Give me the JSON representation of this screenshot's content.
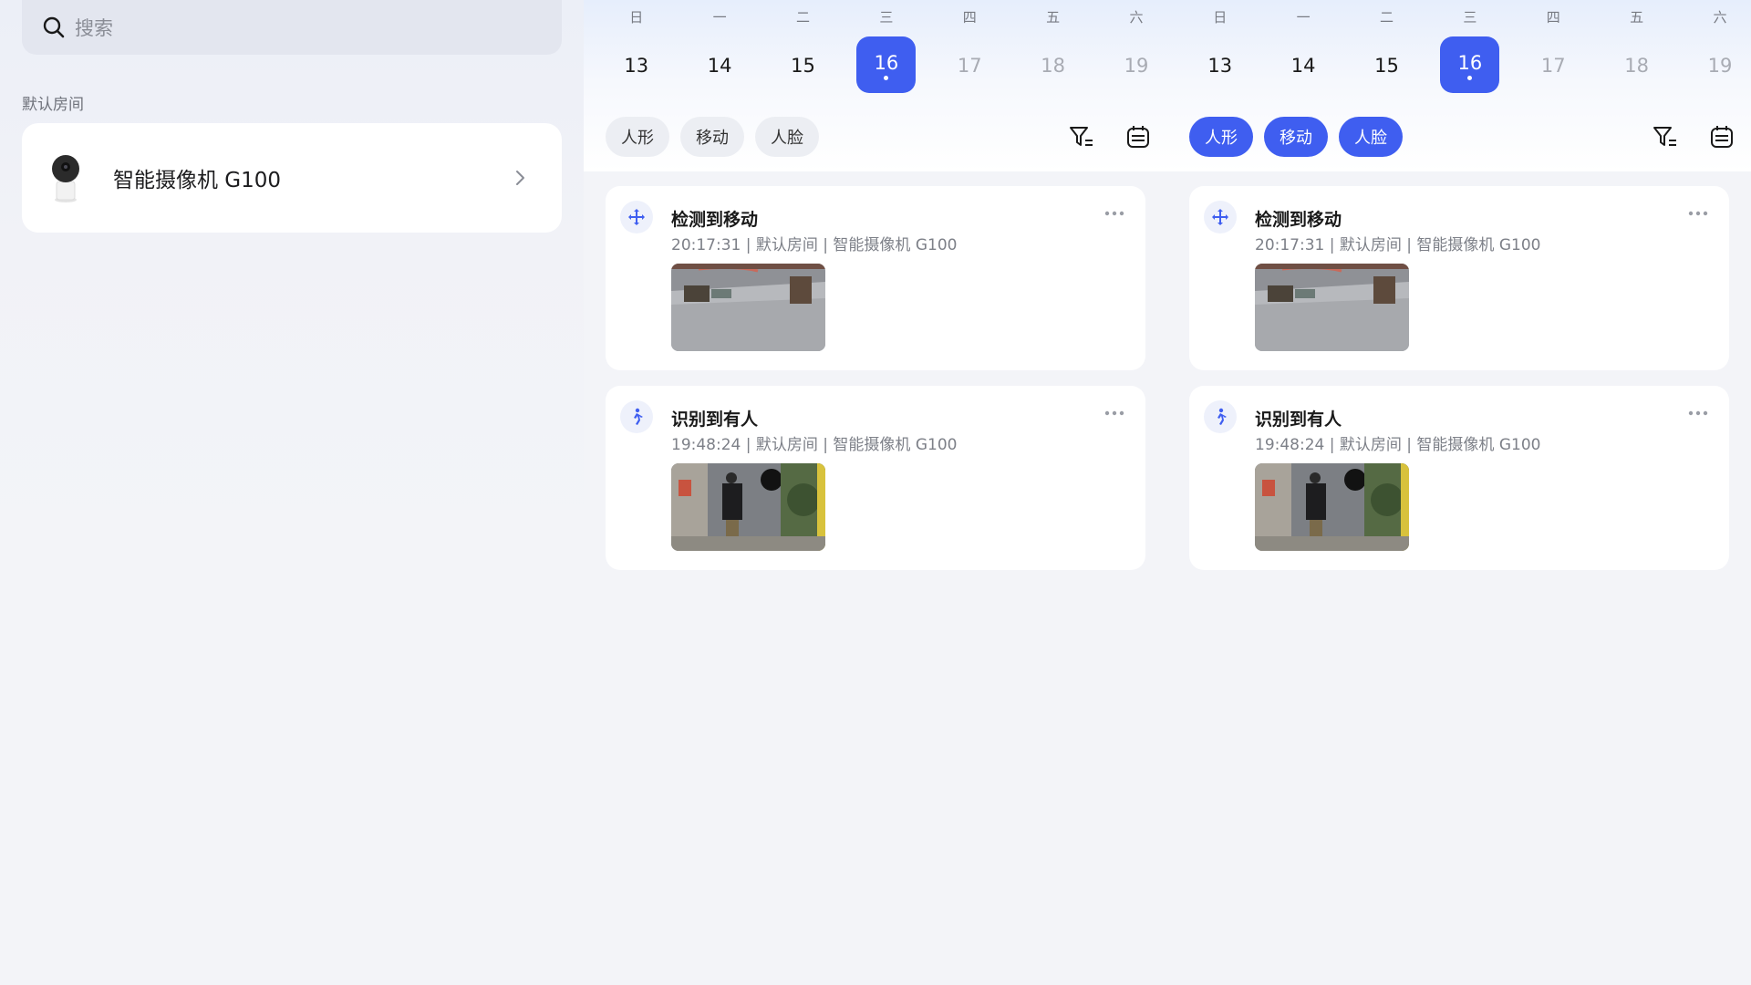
{
  "search": {
    "placeholder": "搜索"
  },
  "room_label": "默认房间",
  "device": {
    "name": "智能摄像机 G100"
  },
  "calendar": {
    "weekdays": [
      "日",
      "一",
      "二",
      "三",
      "四",
      "五",
      "六"
    ],
    "dates": [
      "13",
      "14",
      "15",
      "16",
      "17",
      "18",
      "19"
    ],
    "selected_index": 3,
    "accent": "#3f5ef0"
  },
  "panels": [
    {
      "filters": [
        "人形",
        "移动",
        "人脸"
      ],
      "filters_active": false,
      "events": [
        {
          "title": "检测到移动",
          "meta": "20:17:31 | 默认房间 | 智能摄像机 G100",
          "icon": "move-icon"
        },
        {
          "title": "识别到有人",
          "meta": "19:48:24 | 默认房间 | 智能摄像机 G100",
          "icon": "person-walking-icon"
        }
      ]
    },
    {
      "filters": [
        "人形",
        "移动",
        "人脸"
      ],
      "filters_active": true,
      "events": [
        {
          "title": "检测到移动",
          "meta": "20:17:31 | 默认房间 | 智能摄像机 G100",
          "icon": "move-icon"
        },
        {
          "title": "识别到有人",
          "meta": "19:48:24 | 默认房间 | 智能摄像机 G100",
          "icon": "person-walking-icon"
        }
      ]
    }
  ]
}
